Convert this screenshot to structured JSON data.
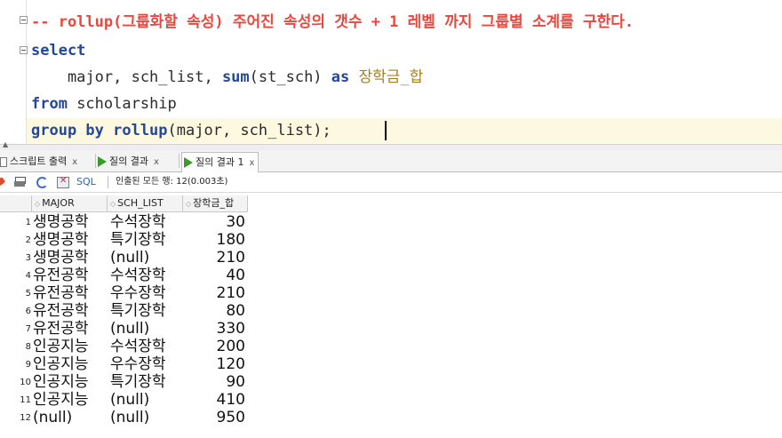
{
  "editor": {
    "comment": "-- rollup(그룹화할 속성) 주어진 속성의 갯수 + 1 레벨 까지 그룹별 소계를 구한다.",
    "line2_kw": "select",
    "line3_cols": "    major, sch_list, ",
    "line3_fn": "sum",
    "line3_args": "(st_sch) ",
    "line3_as": "as",
    "line3_alias": " 장학금_합",
    "line4_kw": "from",
    "line4_rest": " scholarship",
    "line5_kw": "group by rollup",
    "line5_rest": "(major, sch_list);"
  },
  "tabs": [
    {
      "label": "스크립트 출력",
      "close": "x"
    },
    {
      "label": "질의 결과",
      "close": "x"
    },
    {
      "label": "질의 결과 1",
      "close": "x"
    }
  ],
  "toolbar": {
    "sql_label": "SQL",
    "fetch_info": "인출된 모든 행: 12(0.003초)"
  },
  "grid": {
    "columns": [
      "MAJOR",
      "SCH_LIST",
      "장학금_합"
    ],
    "rows": [
      {
        "n": "1",
        "major": "생명공학",
        "sch": "수석장학",
        "sum": "30"
      },
      {
        "n": "2",
        "major": "생명공학",
        "sch": "특기장학",
        "sum": "180"
      },
      {
        "n": "3",
        "major": "생명공학",
        "sch": "(null)",
        "sum": "210"
      },
      {
        "n": "4",
        "major": "유전공학",
        "sch": "수석장학",
        "sum": "40"
      },
      {
        "n": "5",
        "major": "유전공학",
        "sch": "우수장학",
        "sum": "210"
      },
      {
        "n": "6",
        "major": "유전공학",
        "sch": "특기장학",
        "sum": "80"
      },
      {
        "n": "7",
        "major": "유전공학",
        "sch": "(null)",
        "sum": "330"
      },
      {
        "n": "8",
        "major": "인공지능",
        "sch": "수석장학",
        "sum": "200"
      },
      {
        "n": "9",
        "major": "인공지능",
        "sch": "우수장학",
        "sum": "120"
      },
      {
        "n": "10",
        "major": "인공지능",
        "sch": "특기장학",
        "sum": "90"
      },
      {
        "n": "11",
        "major": "인공지능",
        "sch": "(null)",
        "sum": "410"
      },
      {
        "n": "12",
        "major": "(null)",
        "sch": "(null)",
        "sum": "950"
      }
    ]
  }
}
